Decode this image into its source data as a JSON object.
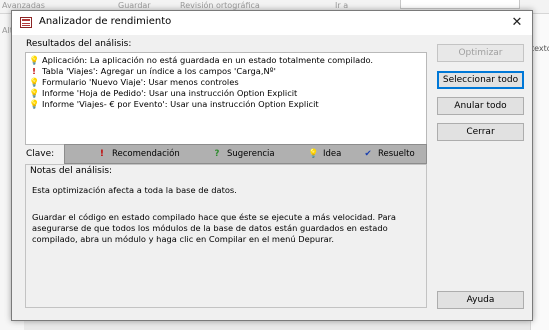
{
  "background": {
    "ribbon_items": [
      "Avanzadas",
      "Guardar",
      "Revisión ortográfica",
      "Ir a"
    ],
    "left_text": "Alt",
    "right_text": "texto"
  },
  "dialog": {
    "title": "Analizador de rendimiento",
    "close_label": "✕"
  },
  "results": {
    "label": "Resultados del análisis:",
    "items": [
      {
        "icon": "idea-icon",
        "text": "Aplicación: La aplicación no está guardada en un estado totalmente compilado."
      },
      {
        "icon": "recommendation-icon",
        "text": "Tabla 'Viajes': Agregar un índice a los campos 'Carga,Nº'"
      },
      {
        "icon": "idea-icon",
        "text": "Formulario 'Nuevo Viaje': Usar menos controles"
      },
      {
        "icon": "idea-icon",
        "text": "Informe 'Hoja de Pedido': Usar una instrucción Option Explicit"
      },
      {
        "icon": "idea-icon",
        "text": "Informe 'Viajes- € por Evento': Usar una instrucción Option Explicit"
      }
    ]
  },
  "buttons": {
    "optimize": "Optimizar",
    "select_all": "Seleccionar todo",
    "cancel_all": "Anular todo",
    "close": "Cerrar",
    "help": "Ayuda"
  },
  "key": {
    "label": "Clave:",
    "items": [
      {
        "icon": "exclamation-icon",
        "glyph": "!",
        "label": "Recomendación"
      },
      {
        "icon": "question-icon",
        "glyph": "?",
        "label": "Sugerencia"
      },
      {
        "icon": "lightbulb-icon",
        "glyph": "💡",
        "label": "Idea"
      },
      {
        "icon": "checkmark-icon",
        "glyph": "✔",
        "label": "Resuelto"
      }
    ]
  },
  "notes": {
    "label": "Notas del análisis:",
    "line1": "Esta optimización afecta a toda la base de datos.",
    "paragraph": "Guardar el código en estado compilado hace que éste se ejecute a más velocidad. Para asegurarse de que todos los módulos de la base de datos están guardados en estado compilado, abra un módulo y haga clic en Compilar en el menú Depurar."
  },
  "colors": {
    "idea": "#d9a800",
    "recommendation": "#c00000",
    "suggestion": "#2e8b2e",
    "resolved": "#1a3fae",
    "default_button_border": "#0078d7"
  }
}
